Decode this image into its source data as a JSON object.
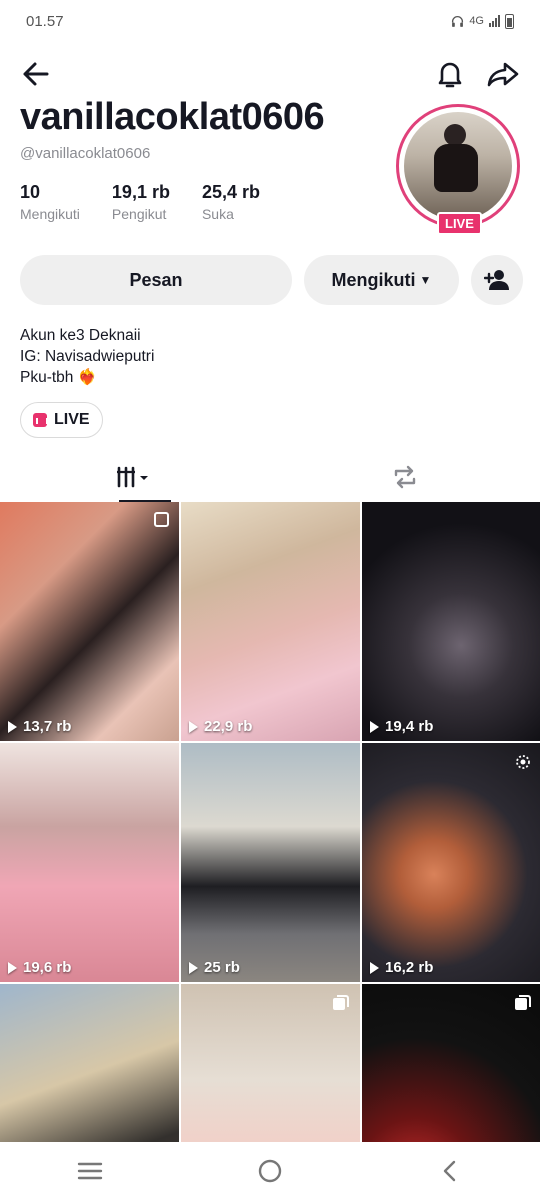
{
  "status_bar": {
    "time": "01.57",
    "network": "4G"
  },
  "profile": {
    "display_name": "vanillacoklat0606",
    "username": "@vanillacoklat0606",
    "live_badge": "LIVE",
    "stats": [
      {
        "value": "10",
        "label": "Mengikuti"
      },
      {
        "value": "19,1 rb",
        "label": "Pengikut"
      },
      {
        "value": "25,4 rb",
        "label": "Suka"
      }
    ],
    "bio": [
      "Akun ke3 Deknaii",
      "IG: Navisadwieputri",
      "Pku-tbh ❤️‍🔥"
    ]
  },
  "actions": {
    "message_label": "Pesan",
    "following_label": "Mengikuti"
  },
  "live_pill": {
    "label": "LIVE"
  },
  "videos": [
    {
      "views": "13,7 rb",
      "icon": "square-icon"
    },
    {
      "views": "22,9 rb"
    },
    {
      "views": "19,4 rb"
    },
    {
      "views": "19,6 rb"
    },
    {
      "views": "25 rb"
    },
    {
      "views": "16,2 rb",
      "icon": "sparkle-icon"
    },
    {
      "views": ""
    },
    {
      "views": "",
      "icon": "carousel-icon"
    },
    {
      "views": "",
      "icon": "carousel-icon"
    }
  ],
  "colors": {
    "accent": "#e8326d",
    "text": "#161823",
    "muted": "#8a8b91",
    "button_bg": "#efefef"
  }
}
